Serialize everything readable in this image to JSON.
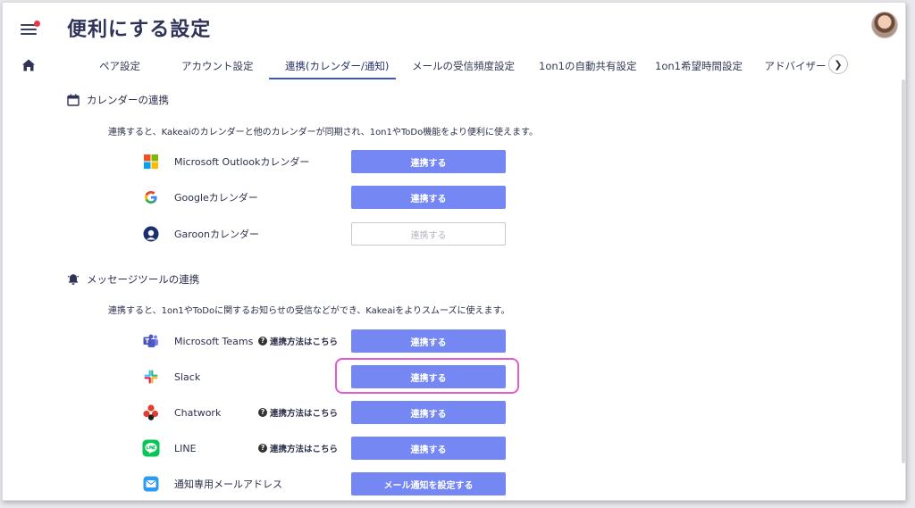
{
  "page": {
    "title": "便利にする設定"
  },
  "tabs": [
    {
      "label": "ペア設定",
      "active": false
    },
    {
      "label": "アカウント設定",
      "active": false
    },
    {
      "label": "連携(カレンダー/通知)",
      "active": true
    },
    {
      "label": "メールの受信頻度設定",
      "active": false
    },
    {
      "label": "1on1の自動共有設定",
      "active": false
    },
    {
      "label": "1on1希望時間設定",
      "active": false
    },
    {
      "label": "アドバイザー",
      "active": false
    }
  ],
  "calendar": {
    "heading": "カレンダーの連携",
    "description": "連携すると、Kakeaiのカレンダーと他のカレンダーが同期され、1on1やToDo機能をより便利に使えます。",
    "items": [
      {
        "label": "Microsoft Outlookカレンダー",
        "button": "連携する"
      },
      {
        "label": "Googleカレンダー",
        "button": "連携する"
      },
      {
        "label": "Garoonカレンダー",
        "button": "連携する"
      }
    ]
  },
  "messaging": {
    "heading": "メッセージツールの連携",
    "description": "連携すると、1on1やToDoに関するお知らせの受信などができ、Kakeaiをよりスムーズに使えます。",
    "help_label": "連携方法はこちら",
    "items": [
      {
        "label": "Microsoft Teams",
        "button": "連携する"
      },
      {
        "label": "Slack",
        "button": "連携する"
      },
      {
        "label": "Chatwork",
        "button": "連携する"
      },
      {
        "label": "LINE",
        "button": "連携する"
      },
      {
        "label": "通知専用メールアドレス",
        "button": "メール通知を設定する"
      }
    ]
  },
  "colors": {
    "primary_button": "#7487f3",
    "active_tab": "#3d56c9",
    "highlight": "#e35bd0",
    "notification_dot": "#e5394a"
  }
}
